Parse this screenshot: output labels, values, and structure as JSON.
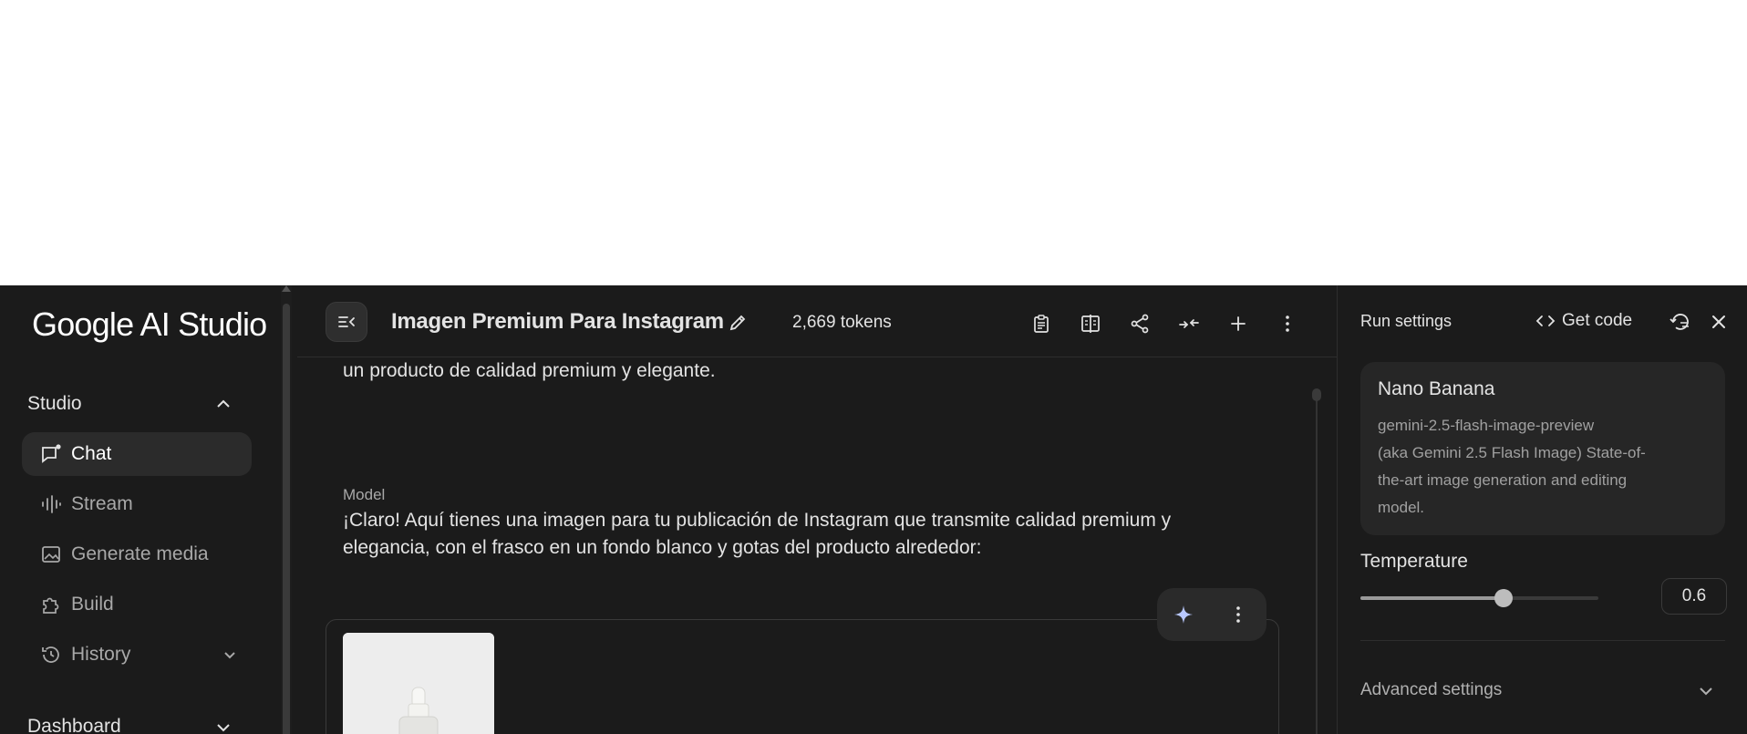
{
  "app": {
    "logo_text": "Google AI Studio"
  },
  "sidebar": {
    "studio_header": "Studio",
    "items": [
      {
        "label": "Chat",
        "icon": "chat-icon",
        "active": true
      },
      {
        "label": "Stream",
        "icon": "waveform-icon",
        "active": false
      },
      {
        "label": "Generate media",
        "icon": "image-icon",
        "active": false
      },
      {
        "label": "Build",
        "icon": "puzzle-icon",
        "active": false
      },
      {
        "label": "History",
        "icon": "history-icon",
        "active": false
      }
    ],
    "dashboard_header": "Dashboard"
  },
  "header": {
    "title": "Imagen Premium Para Instagram",
    "tokens": "2,669 tokens",
    "toolbar_icons": [
      "clipboard-icon",
      "compare-icon",
      "share-icon",
      "compress-icon",
      "add-icon",
      "more-icon"
    ]
  },
  "chat": {
    "user_msg_tail": "un producto de calidad premium y elegante.",
    "model_role": "Model",
    "model_line_1": "¡Claro! Aquí tienes una imagen para tu publicación de Instagram que transmite calidad premium y",
    "model_line_2": "elegancia, con el frasco en un fondo blanco y gotas del producto alrededor:"
  },
  "run_settings": {
    "title": "Run settings",
    "get_code": "Get code",
    "model_name": "Nano Banana",
    "model_desc_lines": [
      "gemini-2.5-flash-image-preview",
      "(aka Gemini 2.5 Flash Image) State-of-",
      "the-art image generation and editing",
      "model."
    ],
    "temperature_label": "Temperature",
    "temperature_value": "0.6",
    "temperature_fraction": 0.6,
    "advanced_label": "Advanced settings"
  }
}
